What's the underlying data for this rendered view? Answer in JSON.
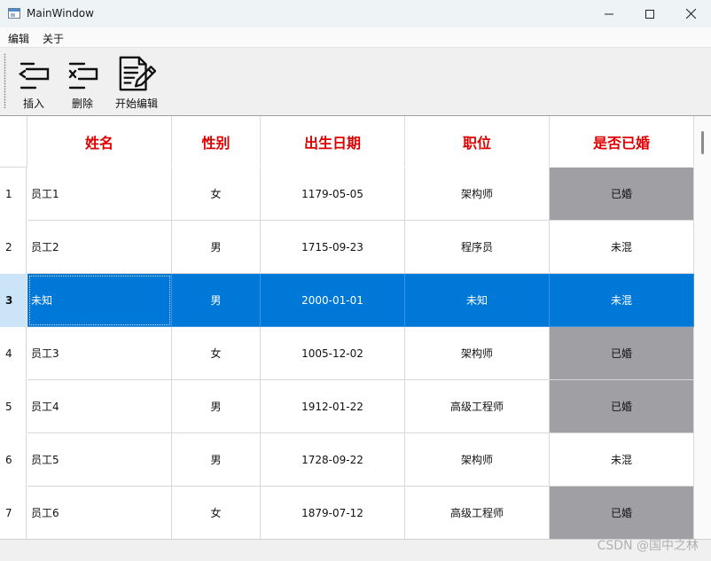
{
  "window": {
    "title": "MainWindow"
  },
  "menu": {
    "items": [
      "编辑",
      "关于"
    ]
  },
  "toolbar": {
    "insert_label": "插入",
    "delete_label": "删除",
    "edit_label": "开始编辑"
  },
  "table": {
    "columns": [
      "姓名",
      "性别",
      "出生日期",
      "职位",
      "是否已婚"
    ],
    "selected_row": 3,
    "rows": [
      {
        "num": "1",
        "name": "员工1",
        "gender": "女",
        "birth": "1179-05-05",
        "position": "架构师",
        "married": "已婚",
        "married_flag": true
      },
      {
        "num": "2",
        "name": "员工2",
        "gender": "男",
        "birth": "1715-09-23",
        "position": "程序员",
        "married": "未混",
        "married_flag": false
      },
      {
        "num": "3",
        "name": "未知",
        "gender": "男",
        "birth": "2000-01-01",
        "position": "未知",
        "married": "未混",
        "married_flag": false
      },
      {
        "num": "4",
        "name": "员工3",
        "gender": "女",
        "birth": "1005-12-02",
        "position": "架构师",
        "married": "已婚",
        "married_flag": true
      },
      {
        "num": "5",
        "name": "员工4",
        "gender": "男",
        "birth": "1912-01-22",
        "position": "高级工程师",
        "married": "已婚",
        "married_flag": true
      },
      {
        "num": "6",
        "name": "员工5",
        "gender": "男",
        "birth": "1728-09-22",
        "position": "架构师",
        "married": "未混",
        "married_flag": false
      },
      {
        "num": "7",
        "name": "员工6",
        "gender": "女",
        "birth": "1879-07-12",
        "position": "高级工程师",
        "married": "已婚",
        "married_flag": true
      }
    ]
  },
  "colors": {
    "header_text": "#e00000",
    "married_bg": "#a0a0a4",
    "selection": "#0078d7"
  },
  "watermark": "CSDN @国中之林"
}
